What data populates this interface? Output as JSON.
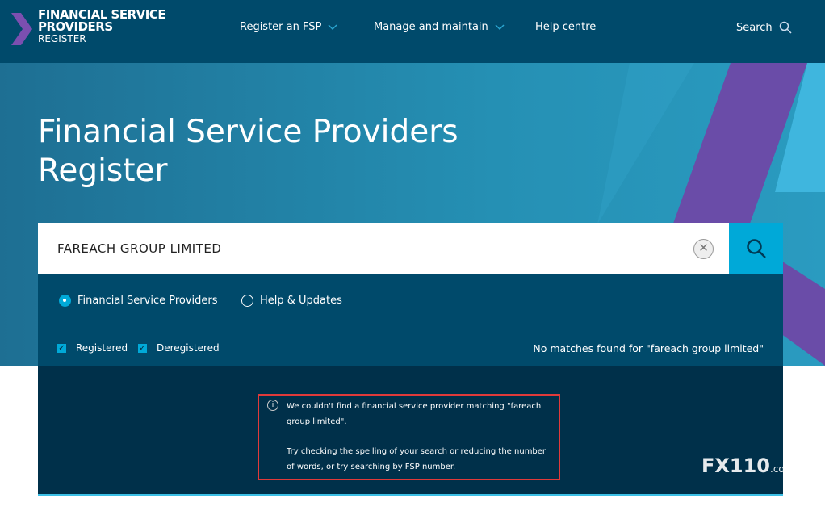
{
  "header": {
    "logo": {
      "line1": "FINANCIAL SERVICE",
      "line2": "PROVIDERS",
      "line3": "REGISTER"
    },
    "nav": [
      {
        "label": "Register an FSP",
        "icon": "chevron-down-icon"
      },
      {
        "label": "Manage and maintain",
        "icon": "chevron-down-icon"
      },
      {
        "label": "Help centre"
      }
    ],
    "search_label": "Search"
  },
  "hero": {
    "title_line1": "Financial Service Providers",
    "title_line2": "Register"
  },
  "search": {
    "value": "FAREACH GROUP LIMITED",
    "clear_icon": "close-icon",
    "button_icon": "search-icon"
  },
  "options": {
    "radios": [
      {
        "label": "Financial Service Providers",
        "selected": true
      },
      {
        "label": "Help & Updates",
        "selected": false
      }
    ],
    "checkboxes": [
      {
        "label": "Registered",
        "checked": true
      },
      {
        "label": "Deregistered",
        "checked": true
      }
    ],
    "status": "No matches found for \"fareach group limited\""
  },
  "results": {
    "message1": "We couldn't find a financial service provider matching \"fareach group limited\".",
    "message2": "Try checking the spelling of your search or reducing the number of words, or try searching by FSP number."
  },
  "watermark": {
    "logo": "FX110",
    "suffix": ".com"
  },
  "colors": {
    "header": "#004a6b",
    "accent": "#00a9d8",
    "results_bg": "#00304a",
    "highlight_border": "#e03a3a",
    "purple": "#6a4ca8"
  }
}
